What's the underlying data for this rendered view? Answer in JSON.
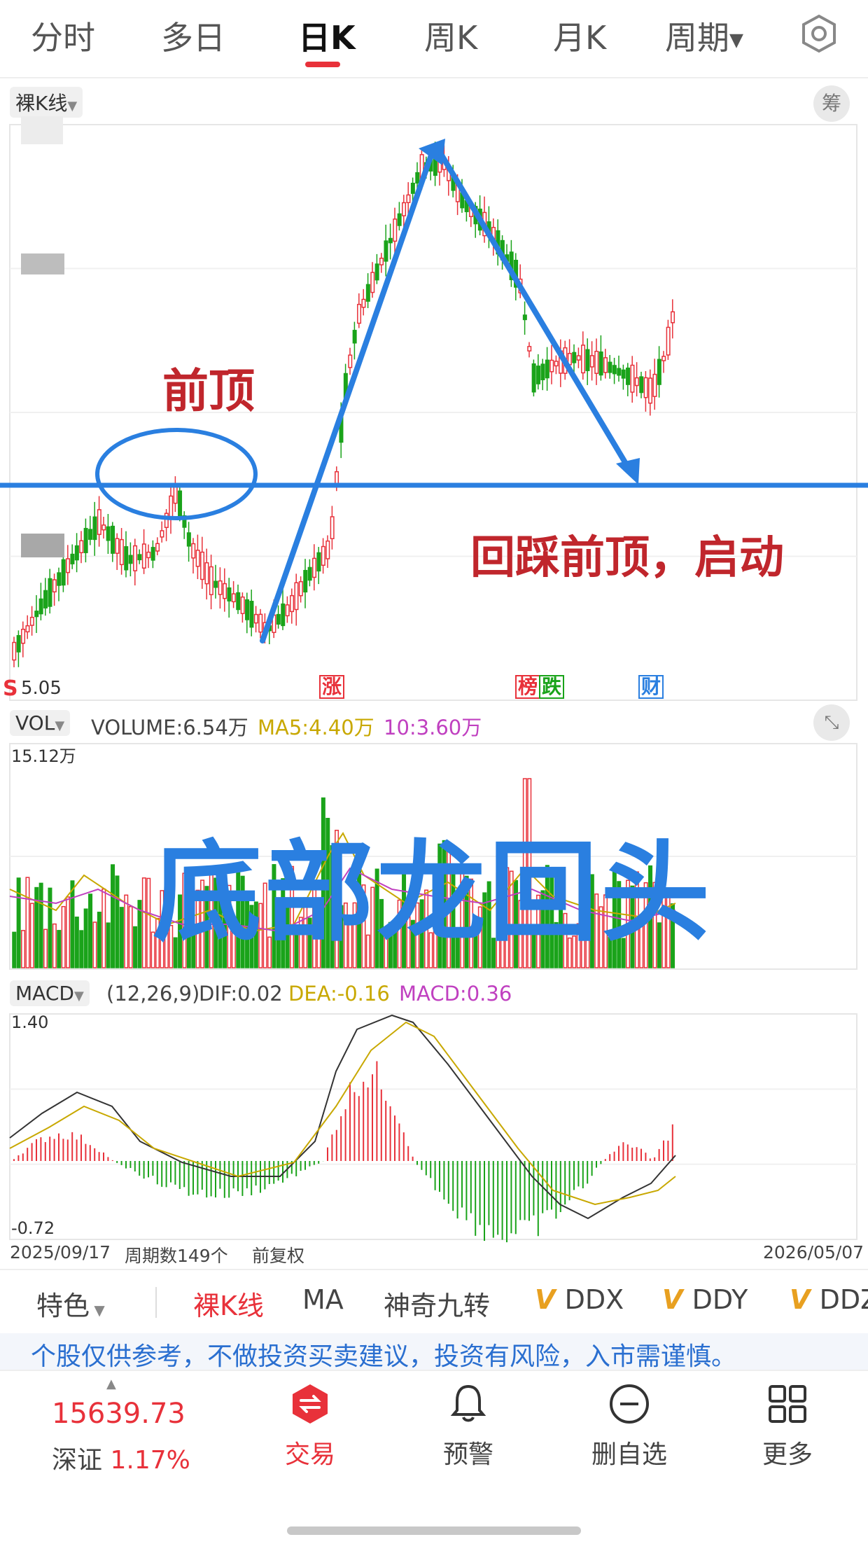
{
  "tabs": [
    {
      "label": "分时"
    },
    {
      "label": "多日"
    },
    {
      "label": "日K"
    },
    {
      "label": "周K"
    },
    {
      "label": "月K"
    },
    {
      "label": "周期"
    }
  ],
  "kline": {
    "type_label": "裸K线",
    "chip_label": "筹",
    "low_label": "5.05",
    "annot_prev_top": "前顶",
    "annot_retest": "回踩前顶，启动",
    "markers": [
      "涨",
      "榜",
      "跌",
      "财"
    ],
    "s_label": "S"
  },
  "volume": {
    "selector": "VOL",
    "volume_text": "VOLUME:6.54万",
    "ma5_text": "MA5:4.40万",
    "ma10_text": "10:3.60万",
    "max_label": "15.12万"
  },
  "overlay_text": "底部龙回头",
  "macd": {
    "selector": "MACD",
    "params": "(12,26,9)",
    "dif_text": "DIF:0.02",
    "dea_text": "DEA:-0.16",
    "macd_text": "MACD:0.36",
    "max_label": "1.40",
    "min_label": "-0.72"
  },
  "footer": {
    "start_date": "2025/09/17",
    "period_count": "周期数149个",
    "adjust": "前复权",
    "end_date": "2026/05/07"
  },
  "indicator_tabs": [
    {
      "label": "特色"
    },
    {
      "label": "裸K线"
    },
    {
      "label": "MA"
    },
    {
      "label": "神奇九转"
    },
    {
      "label": "DDX"
    },
    {
      "label": "DDY"
    },
    {
      "label": "DDZ"
    }
  ],
  "disclaimer": "个股仅供参考，不做投资买卖建议，投资有风险，入市需谨慎。",
  "index": {
    "value": "15639.73",
    "name": "深证",
    "change": "1.17%"
  },
  "bottom_nav": [
    {
      "label": "交易"
    },
    {
      "label": "预警"
    },
    {
      "label": "删自选"
    },
    {
      "label": "更多"
    }
  ],
  "colors": {
    "up": "#e8313a",
    "down": "#1aa31a",
    "annotation_blue": "#2a7fe0",
    "dea": "#c8a800",
    "ma10": "#c040c0",
    "accent": "#e8313a"
  }
}
